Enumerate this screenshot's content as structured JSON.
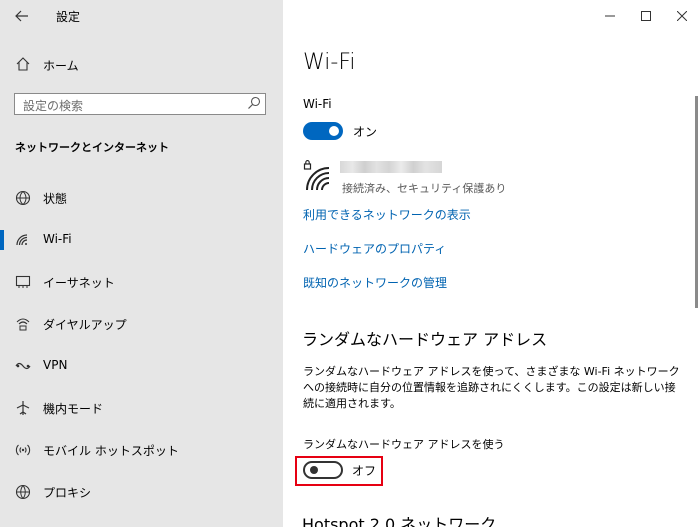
{
  "window": {
    "title": "設定",
    "back_icon": "arrow-left-icon",
    "controls": [
      "minimize-icon",
      "maximize-icon",
      "close-icon"
    ]
  },
  "sidebar": {
    "home_label": "ホーム",
    "search_placeholder": "設定の検索",
    "section_title": "ネットワークとインターネット",
    "items": [
      {
        "label": "状態",
        "icon": "globe-icon"
      },
      {
        "label": "Wi-Fi",
        "icon": "wifi-icon",
        "active": true
      },
      {
        "label": "イーサネット",
        "icon": "ethernet-icon"
      },
      {
        "label": "ダイヤルアップ",
        "icon": "dialup-icon"
      },
      {
        "label": "VPN",
        "icon": "vpn-icon"
      },
      {
        "label": "機内モード",
        "icon": "airplane-icon"
      },
      {
        "label": "モバイル ホットスポット",
        "icon": "hotspot-icon"
      },
      {
        "label": "プロキシ",
        "icon": "proxy-globe-icon"
      }
    ]
  },
  "main": {
    "title": "Wi-Fi",
    "wifi_toggle_label": "Wi-Fi",
    "wifi_toggle_state": "オン",
    "network_status": "接続済み、セキュリティ保護あり",
    "links": [
      "利用できるネットワークの表示",
      "ハードウェアのプロパティ",
      "既知のネットワークの管理"
    ],
    "random_hw_title": "ランダムなハードウェア アドレス",
    "random_hw_desc": "ランダムなハードウェア アドレスを使って、さまざまな Wi-Fi ネットワークへの接続時に自分の位置情報を追跡されにくくします。この設定は新しい接続に適用されます。",
    "random_hw_toggle_label": "ランダムなハードウェア アドレスを使う",
    "random_hw_toggle_state": "オフ",
    "next_section_title": "Hotspot 2.0 ネットワーク"
  },
  "colors": {
    "accent": "#0067c0",
    "link": "#0063b1",
    "highlight": "#e60012",
    "sidebar_bg": "#e6e6e6"
  }
}
